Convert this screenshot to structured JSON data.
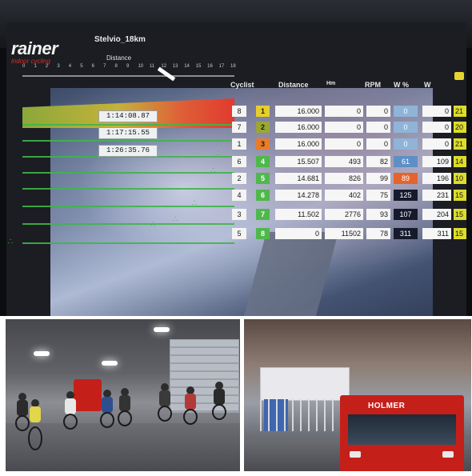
{
  "app": {
    "brand": "rainer",
    "brand_sub": "indoor cycling",
    "course": "Stelvio_18km"
  },
  "header": {
    "distance_label": "Distance",
    "scale_ticks": [
      "0",
      "1",
      "2",
      "3",
      "4",
      "5",
      "6",
      "7",
      "8",
      "9",
      "10",
      "11",
      "12",
      "13",
      "14",
      "15",
      "16",
      "17",
      "18"
    ],
    "columns": {
      "cyclist": "Cyclist",
      "distance": "Distance",
      "hm": "Hm",
      "rpm": "RPM",
      "w_pct": "W %",
      "w": "W"
    }
  },
  "times": [
    "1:14:08.87",
    "1:17:15.55",
    "1:26:35.76"
  ],
  "rows": [
    {
      "pos": "8",
      "cyclist": "1",
      "cyclist_color": "yellow",
      "distance": "16.000",
      "hm": "0",
      "rpm": "0",
      "w_pct": "0",
      "pct_style": "empty",
      "w": "0",
      "wkg": "21"
    },
    {
      "pos": "7",
      "cyclist": "2",
      "cyclist_color": "olive",
      "distance": "16.000",
      "hm": "0",
      "rpm": "0",
      "w_pct": "0",
      "pct_style": "empty",
      "w": "0",
      "wkg": "20"
    },
    {
      "pos": "1",
      "cyclist": "3",
      "cyclist_color": "orange",
      "distance": "16.000",
      "hm": "0",
      "rpm": "0",
      "w_pct": "0",
      "pct_style": "empty",
      "w": "0",
      "wkg": "21"
    },
    {
      "pos": "6",
      "cyclist": "4",
      "cyclist_color": "green",
      "distance": "15.507",
      "hm": "493",
      "rpm": "82",
      "w_pct": "61",
      "pct_style": "blue",
      "w": "109",
      "wkg": "14"
    },
    {
      "pos": "2",
      "cyclist": "5",
      "cyclist_color": "green",
      "distance": "14.681",
      "hm": "826",
      "rpm": "99",
      "w_pct": "89",
      "pct_style": "orange",
      "w": "196",
      "wkg": "10"
    },
    {
      "pos": "4",
      "cyclist": "6",
      "cyclist_color": "green",
      "distance": "14.278",
      "hm": "402",
      "rpm": "75",
      "w_pct": "125",
      "pct_style": "dark",
      "w": "231",
      "wkg": "15"
    },
    {
      "pos": "3",
      "cyclist": "7",
      "cyclist_color": "green",
      "distance": "11.502",
      "hm": "2776",
      "rpm": "93",
      "w_pct": "107",
      "pct_style": "dark",
      "w": "204",
      "wkg": "15"
    },
    {
      "pos": "5",
      "cyclist": "8",
      "cyclist_color": "green",
      "distance": "0",
      "hm": "11502",
      "rpm": "78",
      "w_pct": "311",
      "pct_style": "dark",
      "w": "311",
      "wkg": "15"
    }
  ],
  "truck_right": {
    "label": "HOLMER"
  },
  "colors": {
    "profile_start": "#8ba83a",
    "profile_end": "#e03a2f",
    "lane_green": "#3fb54a",
    "wkg_yellow": "#dcdc2c"
  }
}
